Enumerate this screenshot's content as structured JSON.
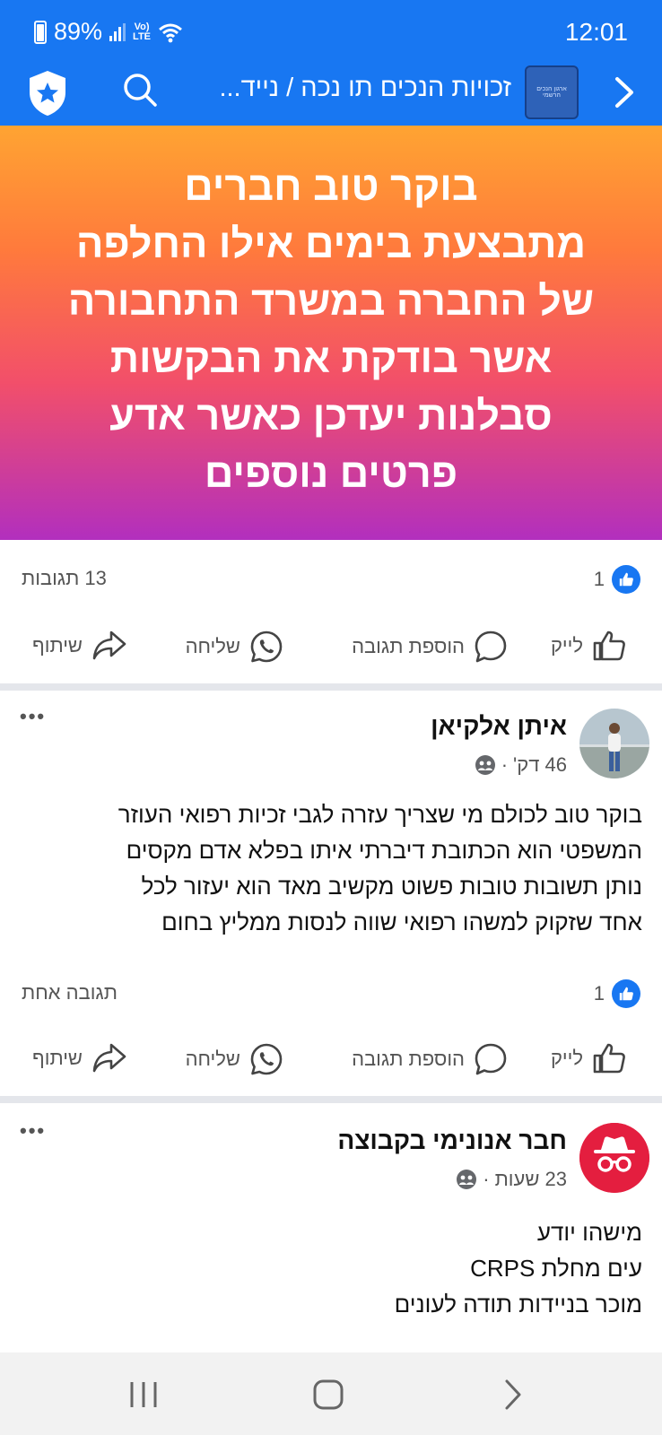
{
  "status": {
    "battery": "89%",
    "volte": "Vo) LTE",
    "time": "12:01"
  },
  "app_bar": {
    "group_name": "זכויות הנכים תו נכה / נייד...",
    "group_thumb_text": "ארגון הנכים הרשמי",
    "icons": [
      "shield-star-icon",
      "search-icon",
      "chevron-right-icon"
    ]
  },
  "post": {
    "banner_lines": [
      "בוקר טוב חברים",
      "מתבצעת בימים אילו החלפה",
      "של החברה במשרד התחבורה",
      "אשר בודקת את הבקשות",
      "סבלנות יעדכן כאשר אדע",
      "פרטים נוספים"
    ],
    "likes": "1",
    "comments": "13 תגובות"
  },
  "actions": {
    "like": "לייק",
    "comment": "הוספת תגובה",
    "send": "שליחה",
    "share": "שיתוף"
  },
  "post2": {
    "author": "איתן אלקיאן",
    "time": "46 דק'",
    "separator": "·",
    "lines": [
      "בוקר טוב לכולם מי שצריך עזרה לגבי זכיות רפואי העוזר",
      "המשפטי הוא הכתובת דיברתי איתו בפלא אדם מקסים",
      "נותן תשובות טובות פשוט מקשיב מאד הוא יעזור לכל",
      "אחד שזקוק למשהו רפואי שווה לנסות ממליץ בחום"
    ],
    "likes": "1",
    "comments": "תגובה אחת"
  },
  "post3": {
    "author": "חבר אנונימי בקבוצה",
    "time": "23 שעות",
    "separator": "·",
    "lines": [
      "מישהו יודע",
      "עים מחלת CRPS",
      "מוכר בניידות תודה לעונים"
    ]
  },
  "colors": {
    "brand": "#1877f2",
    "anon_avatar": "#e41e3f"
  }
}
